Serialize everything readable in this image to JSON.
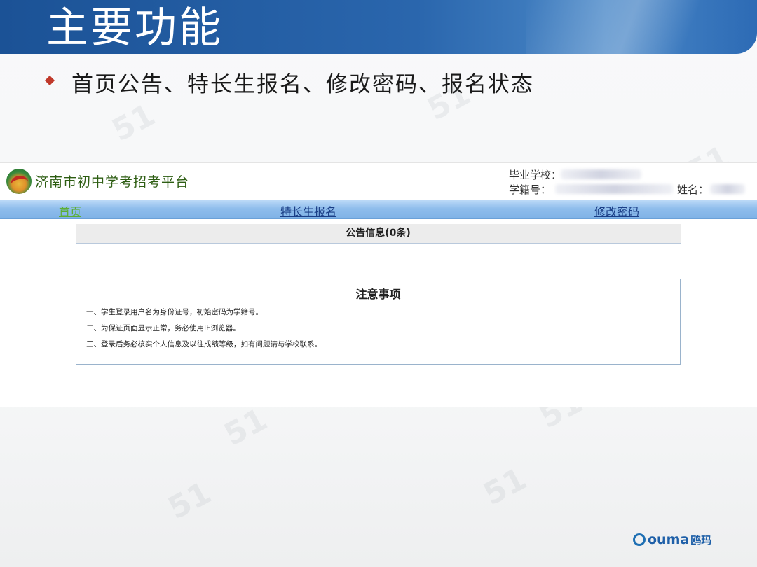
{
  "slide": {
    "title": "主要功能",
    "bullet": "首页公告、特长生报名、修改密码、报名状态",
    "watermark": "51"
  },
  "app": {
    "title": "济南市初中学考招考平台",
    "user": {
      "school_label": "毕业学校：",
      "student_id_label": "学籍号：",
      "name_label": "姓名："
    },
    "nav": [
      {
        "label": "首页",
        "active": true
      },
      {
        "label": "特长生报名",
        "active": false
      },
      {
        "label": "修改密码",
        "active": false
      }
    ],
    "announcement": "公告信息(0条)",
    "notice": {
      "title": "注意事项",
      "items": [
        "一、学生登录用户名为身份证号，初始密码为学籍号。",
        "二、为保证页面显示正常，务必使用IE浏览器。",
        "三、登录后务必核实个人信息及以往成绩等级，如有问题请与学校联系。"
      ]
    }
  },
  "footer": {
    "brand": "ouma",
    "brand_cn": "鸥玛"
  },
  "colors": {
    "header_blue": "#1b5296",
    "nav_blue": "#8fbdec",
    "active_link": "#5cae33",
    "link": "#1a3e86",
    "bullet_red": "#c0392b"
  }
}
